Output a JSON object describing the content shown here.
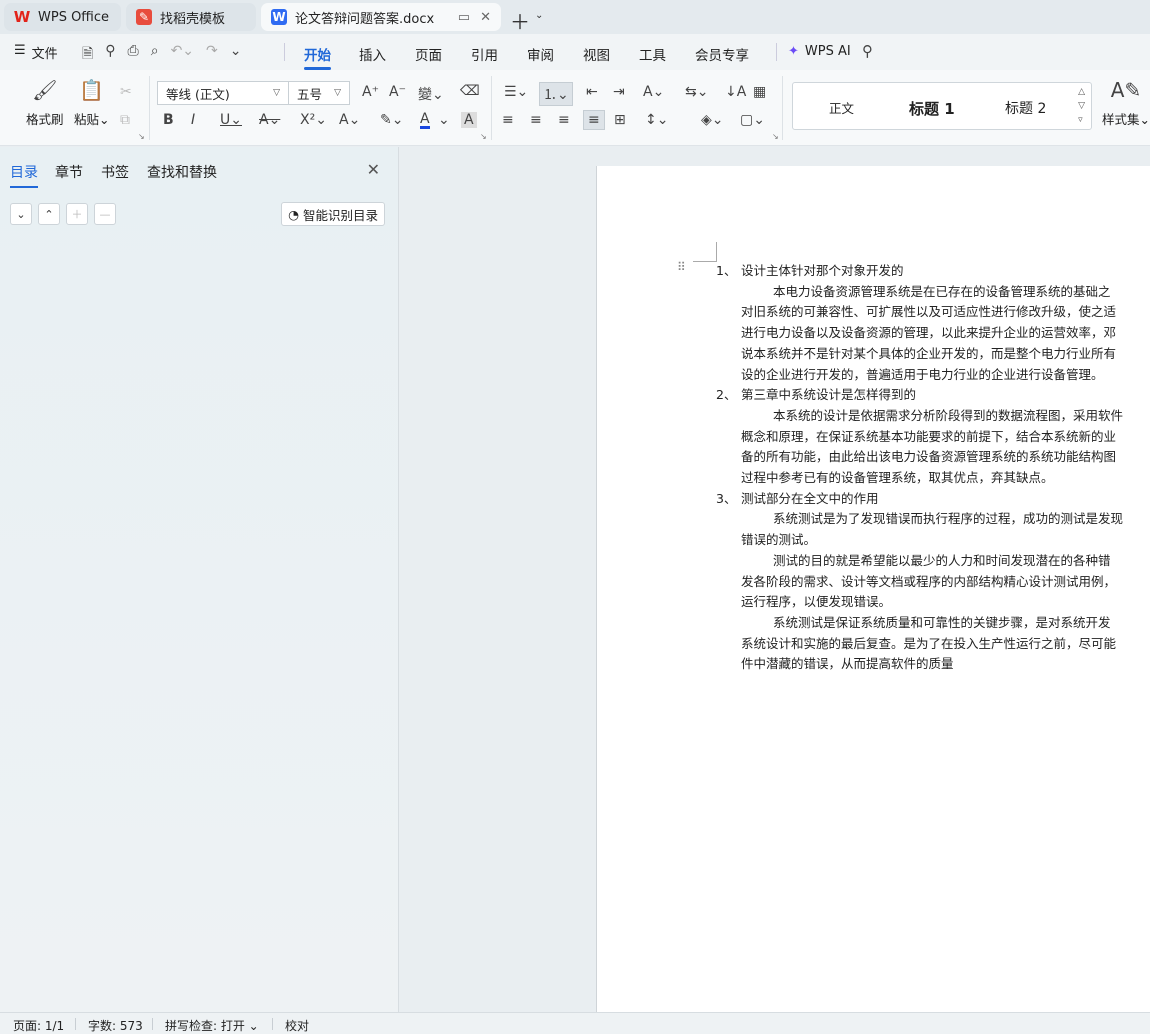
{
  "tabs": [
    {
      "label": "WPS Office",
      "icon": "wps-logo-icon"
    },
    {
      "label": "找稻壳模板",
      "icon": "docer-logo-icon"
    },
    {
      "label": "论文答辩问题答案.docx",
      "icon": "word-doc-icon"
    }
  ],
  "menu": {
    "file_label": "文件",
    "tabs": [
      "开始",
      "插入",
      "页面",
      "引用",
      "审阅",
      "视图",
      "工具",
      "会员专享"
    ],
    "active_tab": "开始",
    "ai_label": "WPS AI"
  },
  "ribbon": {
    "format_painter": "格式刷",
    "paste": "粘贴",
    "font_name": "等线 (正文)",
    "font_size": "五号",
    "styles": [
      "正文",
      "标题 1",
      "标题 2"
    ],
    "style_set": "样式集",
    "font_color": "#1a47e0"
  },
  "nav": {
    "tabs": [
      "目录",
      "章节",
      "书签",
      "查找和替换"
    ],
    "active_tab": "目录",
    "smart_toc": "智能识别目录"
  },
  "document": {
    "lines": [
      {
        "type": "li",
        "num": "1、",
        "text": "设计主体针对那个对象开发的"
      },
      {
        "type": "p",
        "first": true,
        "text": "本电力设备资源管理系统是在已存在的设备管理系统的基础之"
      },
      {
        "type": "p",
        "text": "对旧系统的可兼容性、可扩展性以及可适应性进行修改升级，使之适"
      },
      {
        "type": "p",
        "text": "进行电力设备以及设备资源的管理，以此来提升企业的运营效率，邓"
      },
      {
        "type": "p",
        "text": "说本系统并不是针对某个具体的企业开发的，而是整个电力行业所有"
      },
      {
        "type": "p",
        "text": "设的企业进行开发的，普遍适用于电力行业的企业进行设备管理。"
      },
      {
        "type": "li",
        "num": "2、",
        "text": "第三章中系统设计是怎样得到的"
      },
      {
        "type": "p",
        "first": true,
        "text": "本系统的设计是依据需求分析阶段得到的数据流程图，采用软件"
      },
      {
        "type": "p",
        "text": "概念和原理，在保证系统基本功能要求的前提下，结合本系统新的业"
      },
      {
        "type": "p",
        "text": "备的所有功能，由此给出该电力设备资源管理系统的系统功能结构图"
      },
      {
        "type": "p",
        "text": "过程中参考已有的设备管理系统，取其优点，弃其缺点。"
      },
      {
        "type": "li",
        "num": "3、",
        "text": "测试部分在全文中的作用"
      },
      {
        "type": "p",
        "first": true,
        "text": "系统测试是为了发现错误而执行程序的过程，成功的测试是发现"
      },
      {
        "type": "p",
        "text": "错误的测试。"
      },
      {
        "type": "p",
        "first": true,
        "text": "测试的目的就是希望能以最少的人力和时间发现潜在的各种错"
      },
      {
        "type": "p",
        "text": "发各阶段的需求、设计等文档或程序的内部结构精心设计测试用例，"
      },
      {
        "type": "p",
        "text": "运行程序，以便发现错误。"
      },
      {
        "type": "p2",
        "first": true,
        "text": "系统测试是保证系统质量和可靠性的关键步骤，是对系统开发"
      },
      {
        "type": "p2",
        "text": "系统设计和实施的最后复查。是为了在投入生产性运行之前，尽可能"
      },
      {
        "type": "p2",
        "text": "件中潜藏的错误，从而提高软件的质量"
      }
    ]
  },
  "status": {
    "page": "页面: 1/1",
    "words": "字数: 573",
    "spell": "拼写检查: 打开",
    "proof": "校对"
  }
}
